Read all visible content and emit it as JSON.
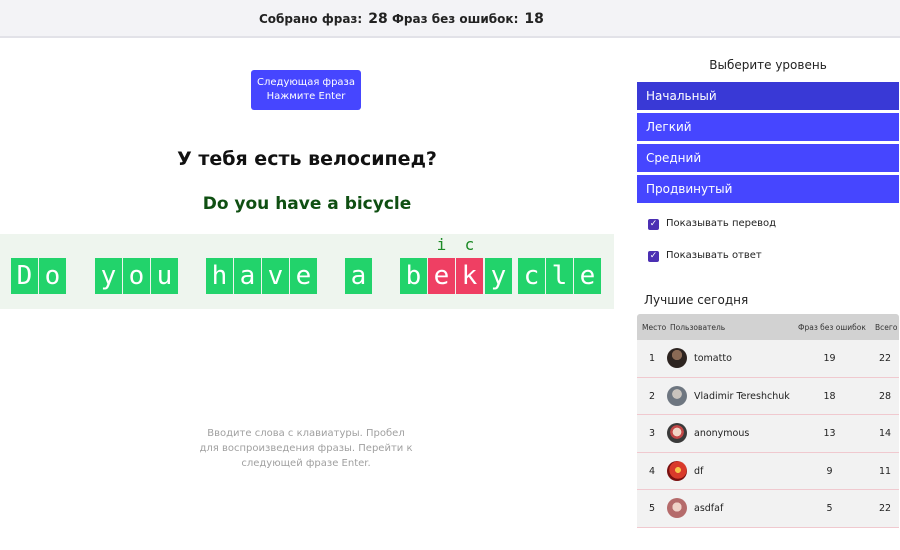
{
  "stats": {
    "collected_label": "Собрано фраз:",
    "collected_value": "28",
    "noerror_label": "Фраз без ошибок:",
    "noerror_value": "18"
  },
  "next_button": {
    "line1": "Следующая фраза",
    "line2": "Нажмите Enter"
  },
  "question": "У тебя есть велосипед?",
  "answer": "Do you have a bicycle",
  "typed": [
    "D",
    "o",
    "y",
    "o",
    "u",
    "h",
    "a",
    "v",
    "e",
    "a",
    "b",
    "e",
    "k",
    "y",
    "c",
    "l",
    "e"
  ],
  "corrections": [
    "i",
    "c"
  ],
  "hint": "Вводите слова с клавиатуры. Пробел для воспроизведения фразы. Перейти к следующей фразе Enter.",
  "levels": {
    "title": "Выберите уровень",
    "items": [
      "Начальный",
      "Легкий",
      "Средний",
      "Продвинутый"
    ]
  },
  "options": {
    "show_translation": "Показывать перевод",
    "show_answer": "Показывать ответ"
  },
  "leaderboard": {
    "title": "Лучшие сегодня",
    "headers": {
      "place": "Место",
      "user": "Пользователь",
      "no_errors": "Фраз без ошибок",
      "total": "Всего"
    },
    "rows": [
      {
        "place": "1",
        "user": "tomatto",
        "no_errors": "19",
        "total": "22"
      },
      {
        "place": "2",
        "user": "Vladimir Tereshchuk",
        "no_errors": "18",
        "total": "28"
      },
      {
        "place": "3",
        "user": "anonymous",
        "no_errors": "13",
        "total": "14"
      },
      {
        "place": "4",
        "user": "df",
        "no_errors": "9",
        "total": "11"
      },
      {
        "place": "5",
        "user": "asdfaf",
        "no_errors": "5",
        "total": "22"
      }
    ]
  },
  "colors": {
    "accent": "#4646ff",
    "accent_active": "#3939d6",
    "correct": "#22d36b",
    "error": "#ef3f63",
    "answer_text": "#0f4f12"
  }
}
